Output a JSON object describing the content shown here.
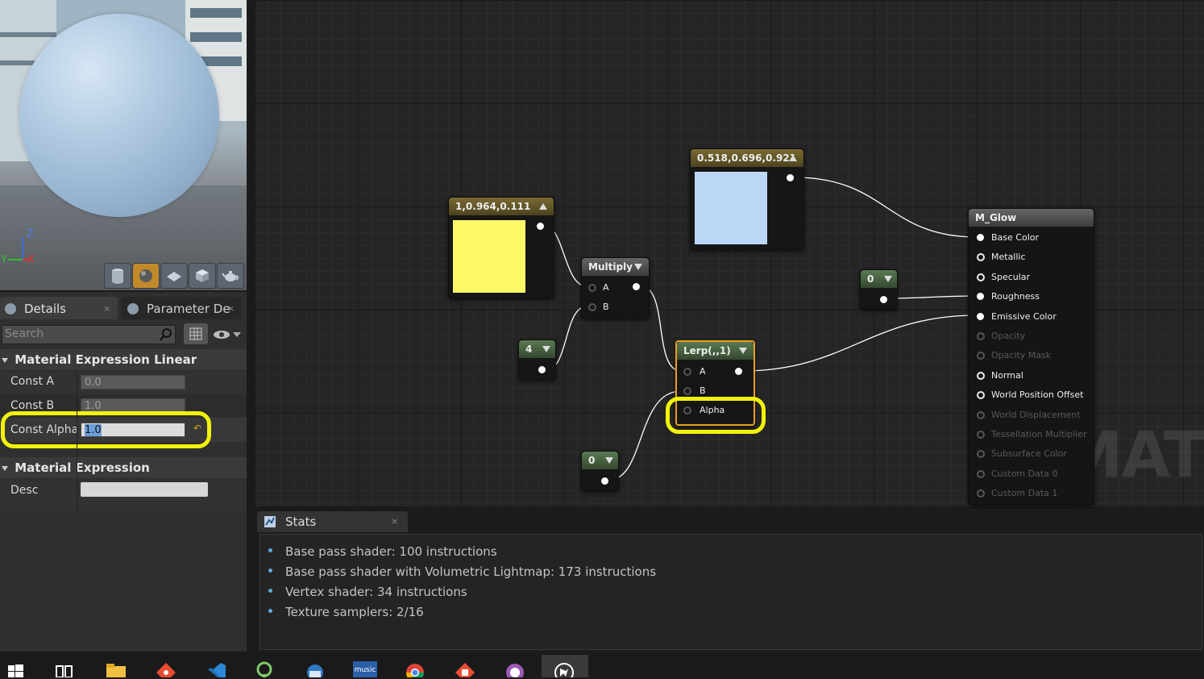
{
  "viewport": {
    "axis_z": "Z",
    "axis_y": "Y",
    "axis_x": "X",
    "buttons": [
      "cylinder-icon",
      "sphere-icon",
      "plane-icon",
      "cube-icon",
      "teapot-icon"
    ]
  },
  "details_panel": {
    "tabs": [
      {
        "label": "Details"
      },
      {
        "label": "Parameter De"
      }
    ],
    "search_placeholder": "Search",
    "category1": "Material Expression Linear Interpolate",
    "props": [
      {
        "label": "Const A",
        "value": "0.0"
      },
      {
        "label": "Const B",
        "value": "1.0"
      },
      {
        "label": "Const Alpha",
        "value": "1.0"
      }
    ],
    "category2": "Material Expression",
    "desc_label": "Desc",
    "desc_value": ""
  },
  "graph": {
    "yellow_node_title": "1,0.964,0.111",
    "yellow_color": "#fdf867",
    "blue_node_title": "0.518,0.696,0.921",
    "blue_color": "#bcd6f6",
    "multiply_title": "Multiply",
    "multiply_pin_a": "A",
    "multiply_pin_b": "B",
    "const4_title": "4",
    "const0_right_title": "0",
    "const0_bottom_title": "0",
    "lerp_title": "Lerp(,,1)",
    "lerp_pin_a": "A",
    "lerp_pin_b": "B",
    "lerp_pin_alpha": "Alpha",
    "result_title": "M_Glow",
    "result_pins": [
      {
        "label": "Base Color",
        "active": true
      },
      {
        "label": "Metallic",
        "active": true
      },
      {
        "label": "Specular",
        "active": true
      },
      {
        "label": "Roughness",
        "active": true
      },
      {
        "label": "Emissive Color",
        "active": true
      },
      {
        "label": "Opacity",
        "active": false
      },
      {
        "label": "Opacity Mask",
        "active": false
      },
      {
        "label": "Normal",
        "active": true
      },
      {
        "label": "World Position Offset",
        "active": true
      },
      {
        "label": "World Displacement",
        "active": false
      },
      {
        "label": "Tessellation Multiplier",
        "active": false
      },
      {
        "label": "Subsurface Color",
        "active": false
      },
      {
        "label": "Custom Data 0",
        "active": false
      },
      {
        "label": "Custom Data 1",
        "active": false
      }
    ],
    "watermark": "MATERIA"
  },
  "stats": {
    "tab_label": "Stats",
    "lines": [
      "Base pass shader: 100 instructions",
      "Base pass shader with Volumetric Lightmap: 173 instructions",
      "Vertex shader: 34 instructions",
      "Texture samplers: 2/16"
    ]
  },
  "taskbar": {
    "icons": [
      "windows-start-icon",
      "task-view-icon",
      "file-explorer-icon",
      "git-icon",
      "vscode-icon",
      "sourcetree-icon",
      "thunderbird-icon",
      "music-app-icon",
      "chrome-icon",
      "git-gui-icon",
      "github-icon",
      "unreal-engine-icon"
    ],
    "music_label": "music"
  },
  "colors": {
    "highlight": "#f2f20a",
    "accent": "#c08a2a"
  }
}
